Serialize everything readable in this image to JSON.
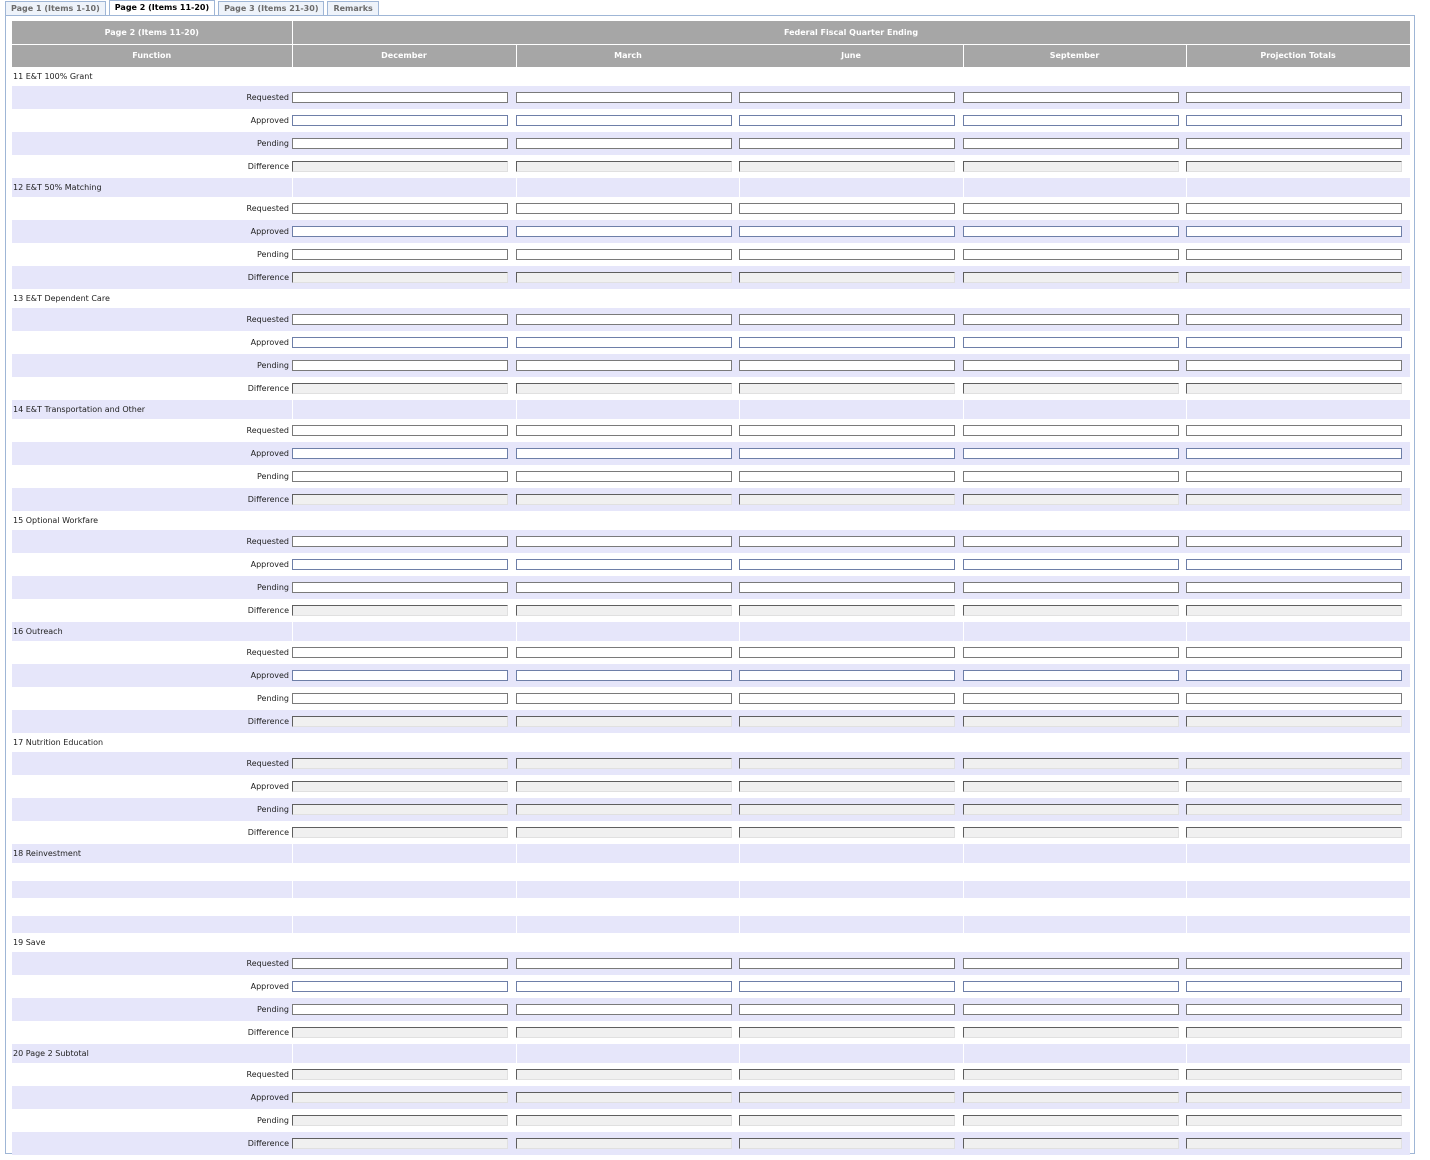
{
  "tabs": [
    {
      "label": "Page 1 (Items 1-10)",
      "active": false
    },
    {
      "label": "Page 2 (Items 11-20)",
      "active": true
    },
    {
      "label": "Page 3 (Items 21-30)",
      "active": false
    },
    {
      "label": "Remarks",
      "active": false
    }
  ],
  "header": {
    "page_title": "Page 2 (Items 11-20)",
    "quarter_title": "Federal Fiscal Quarter Ending",
    "function_label": "Function",
    "columns": [
      "December",
      "March",
      "June",
      "September",
      "Projection Totals"
    ]
  },
  "line_labels": [
    "Requested",
    "Approved",
    "Pending",
    "Difference"
  ],
  "groups": [
    {
      "title": "11 E&T 100% Grant",
      "has_lines": true,
      "readonly": [
        false,
        false,
        false,
        true
      ]
    },
    {
      "title": "12 E&T 50% Matching",
      "has_lines": true,
      "readonly": [
        false,
        false,
        false,
        true
      ]
    },
    {
      "title": "13 E&T Dependent Care",
      "has_lines": true,
      "readonly": [
        false,
        false,
        false,
        true
      ]
    },
    {
      "title": "14 E&T Transportation and Other",
      "has_lines": true,
      "readonly": [
        false,
        false,
        false,
        true
      ]
    },
    {
      "title": "15 Optional Workfare",
      "has_lines": true,
      "readonly": [
        false,
        false,
        false,
        true
      ]
    },
    {
      "title": "16 Outreach",
      "has_lines": true,
      "readonly": [
        false,
        false,
        false,
        true
      ]
    },
    {
      "title": "17 Nutrition Education",
      "has_lines": true,
      "readonly": [
        true,
        true,
        true,
        true
      ]
    },
    {
      "title": "18 Reinvestment",
      "has_lines": false,
      "readonly": []
    },
    {
      "title": "19 Save",
      "has_lines": true,
      "readonly": [
        false,
        false,
        false,
        true
      ]
    },
    {
      "title": "20 Page 2 Subtotal",
      "has_lines": true,
      "readonly": [
        true,
        true,
        true,
        true
      ]
    }
  ]
}
